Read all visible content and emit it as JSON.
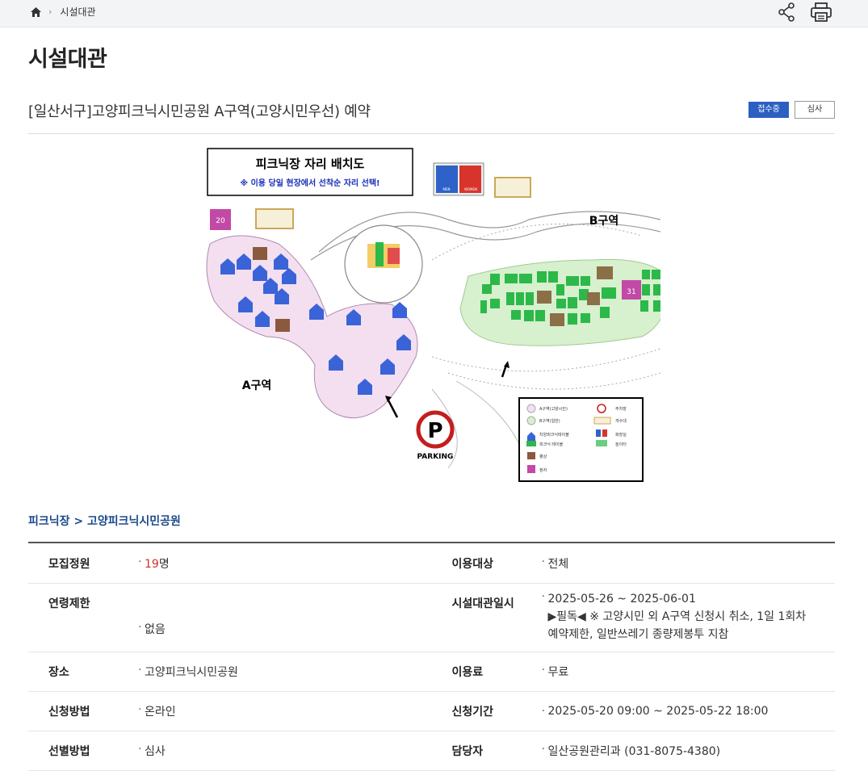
{
  "breadcrumb": {
    "home_icon": "home-icon",
    "current": "시설대관"
  },
  "toolbar": {
    "share_icon": "share-icon",
    "print_icon": "print-icon"
  },
  "page_title": "시설대관",
  "facility": {
    "title": "[일산서구]고양피크닉시민공원 A구역(고양시민우선) 예약",
    "status_badge": "접수중",
    "review_badge": "심사"
  },
  "map": {
    "heading": "피크닉장 자리 배치도",
    "notice": "※ 이용 당일 현장에서 선착순 자리 선택!",
    "zone_a": "A구역",
    "zone_b": "B구역",
    "parking": "PARKING",
    "restroom_men": "MEN",
    "restroom_women": "WOMEN",
    "legend": [
      {
        "label": "A구역(고양시민)"
      },
      {
        "label": "주차장"
      },
      {
        "label": "B구역(일반)"
      },
      {
        "label": "개수대"
      },
      {
        "label": "차양피크닉테이블"
      },
      {
        "label": "화장실"
      },
      {
        "label": "피크닉 테이블"
      },
      {
        "label": "놀이터"
      },
      {
        "label": "평상"
      },
      {
        "label": "정자"
      }
    ],
    "colors": {
      "zone_a": "#f3dff0",
      "zone_b": "#d7f0cd",
      "shade_table": "#3a63d8",
      "table": "#2db84a",
      "platform": "#8b6f47",
      "pavilion": "#c24aa6"
    }
  },
  "category_path": "피크닉장 > 고양피크닉시민공원",
  "info": {
    "rows": [
      {
        "l_label": "모집정원",
        "l_value_num": "19",
        "l_value_unit": "명",
        "r_label": "이용대상",
        "r_value": "전체"
      },
      {
        "l_label": "연령제한",
        "l_value": "없음",
        "r_label": "시설대관일시",
        "r_value_1": "2025-05-26 ~ 2025-06-01",
        "r_value_2": "▶필독◀ ※ 고양시민 외 A구역 신청시 취소, 1일 1회차",
        "r_value_3": "예약제한, 일반쓰레기 종량제봉투 지참"
      },
      {
        "l_label": "장소",
        "l_value": "고양피크닉시민공원",
        "r_label": "이용료",
        "r_value": "무료"
      },
      {
        "l_label": "신청방법",
        "l_value": "온라인",
        "r_label": "신청기간",
        "r_value": "2025-05-20 09:00 ~ 2025-05-22 18:00"
      },
      {
        "l_label": "선별방법",
        "l_value": "심사",
        "r_label": "담당자",
        "r_value": "일산공원관리과 (031-8075-4380)"
      }
    ]
  }
}
